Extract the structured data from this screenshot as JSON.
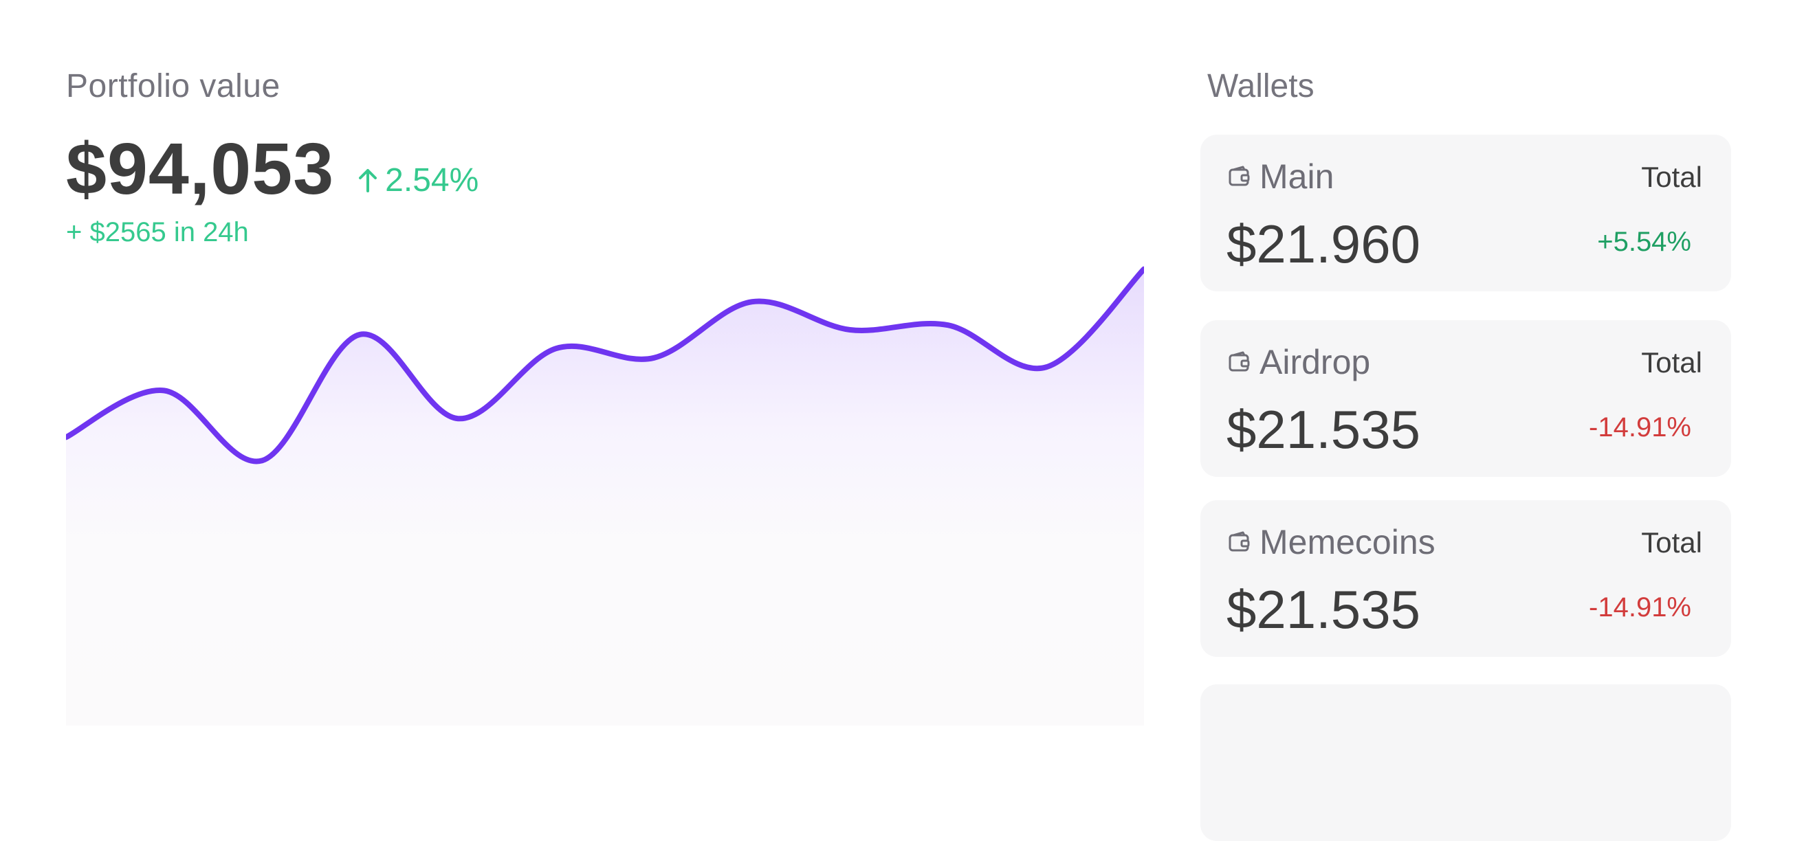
{
  "portfolio": {
    "label": "Portfolio value",
    "value": "$94,053",
    "change_pct": "2.54%",
    "change_abs": "+ $2565 in 24h",
    "accent_color": "#35c98e",
    "line_color": "#6f35f0"
  },
  "chart_data": {
    "type": "area",
    "title": "",
    "xlabel": "",
    "ylabel": "",
    "grid": false,
    "x": [
      0,
      1,
      2,
      3,
      4,
      5,
      6,
      7,
      8,
      9,
      10,
      11
    ],
    "values": [
      52,
      62,
      47,
      74,
      56,
      71,
      69,
      81,
      75,
      76,
      67,
      88
    ],
    "ylim": [
      0,
      100
    ]
  },
  "wallets": {
    "title": "Wallets",
    "icon": "wallet-icon",
    "items": [
      {
        "name": "Main",
        "total_label": "Total",
        "amount": "$21.960",
        "change": "+5.54%",
        "change_color": "#1f9f63"
      },
      {
        "name": "Airdrop",
        "total_label": "Total",
        "amount": "$21.535",
        "change": "-14.91%",
        "change_color": "#d23c3c"
      },
      {
        "name": "Memecoins",
        "total_label": "Total",
        "amount": "$21.535",
        "change": "-14.91%",
        "change_color": "#d23c3c"
      },
      {
        "name": "",
        "total_label": "",
        "amount": "",
        "change": "",
        "change_color": "#d23c3c"
      }
    ]
  }
}
